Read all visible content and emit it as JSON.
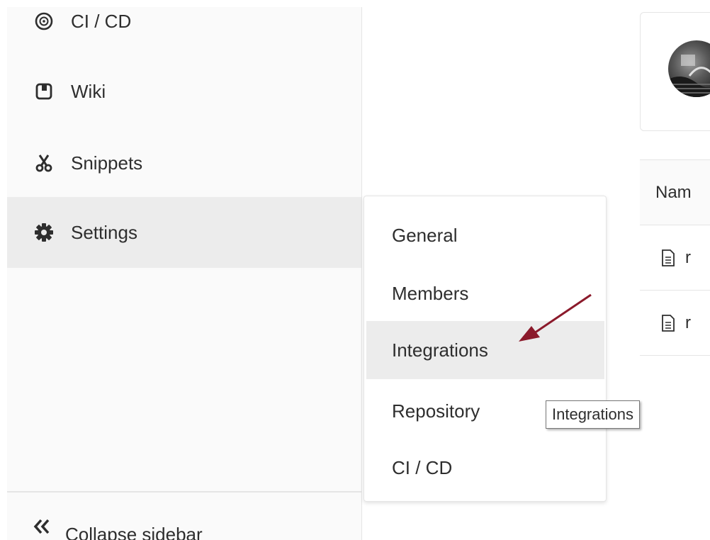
{
  "sidebar": {
    "items": [
      {
        "label": "CI / CD",
        "icon": "rocket-icon"
      },
      {
        "label": "Wiki",
        "icon": "book-icon"
      },
      {
        "label": "Snippets",
        "icon": "scissors-icon"
      },
      {
        "label": "Settings",
        "icon": "gear-icon",
        "active": true
      }
    ],
    "collapse_label": "Collapse sidebar"
  },
  "flyout": {
    "items": [
      {
        "label": "General"
      },
      {
        "label": "Members"
      },
      {
        "label": "Integrations",
        "hover": true
      },
      {
        "label": "Repository"
      },
      {
        "label": "CI / CD"
      }
    ]
  },
  "tooltip": {
    "text": "Integrations"
  },
  "content": {
    "table_header": "Nam",
    "rows": [
      {
        "name": "r"
      },
      {
        "name": "r"
      }
    ]
  },
  "colors": {
    "arrow": "#8b1a2b",
    "active_bg": "#ececec"
  }
}
